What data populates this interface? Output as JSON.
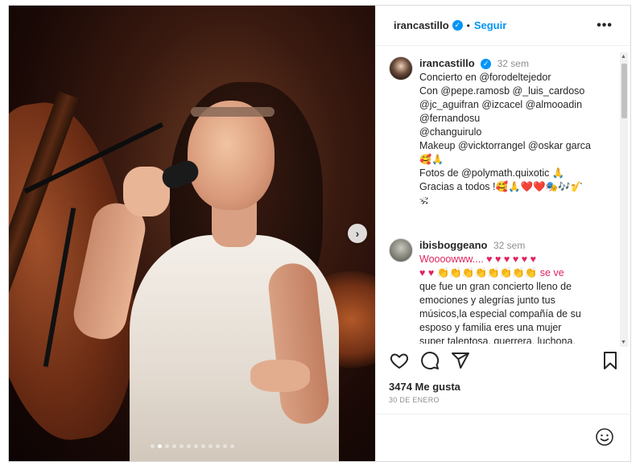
{
  "post": {
    "username": "irancastillo",
    "separator": "•",
    "follow_label": "Seguir",
    "more_label": "•••",
    "next_label": "›",
    "carousel_count": 12,
    "carousel_active": 1
  },
  "comments": [
    {
      "username": "irancastillo",
      "time": "32 sem",
      "lines": [
        "Concierto en @forodeltejedor",
        "Con @pepe.ramosb @_luis_cardoso",
        "@jc_aguifran @izcacel @almooadin",
        "@fernandosu",
        "@changuirulo",
        "Makeup @vicktorrangel @oskar garca",
        "🥰🙏",
        "Fotos de @polymath.quixotic 🙏",
        "Gracias a todos !🥰🙏❤️❤️🎭🎶🎷",
        "🕉"
      ]
    },
    {
      "username": "ibisboggeano",
      "time": "32 sem",
      "lines": [
        "Woooowww.... ♥ ♥ ♥ ♥ ♥ ♥",
        "♥ ♥ 👏👏👏👏👏👏👏👏 se ve",
        "que fue un gran concierto lleno de",
        "emociones y alegrías junto tus",
        "músicos,la especial compañía de su",
        "esposo y familia eres una mujer",
        "super talentosa, guerrera, luchona,"
      ]
    }
  ],
  "likes": "3474 Me gusta",
  "date": "30 DE ENERO",
  "icons": {
    "like": "heart-icon",
    "comment": "comment-icon",
    "share": "share-icon",
    "save": "bookmark-icon",
    "emoji": "smiley-icon"
  },
  "colors": {
    "link": "#0095f6",
    "verified": "#0095f6",
    "heart": "#e0245e"
  }
}
